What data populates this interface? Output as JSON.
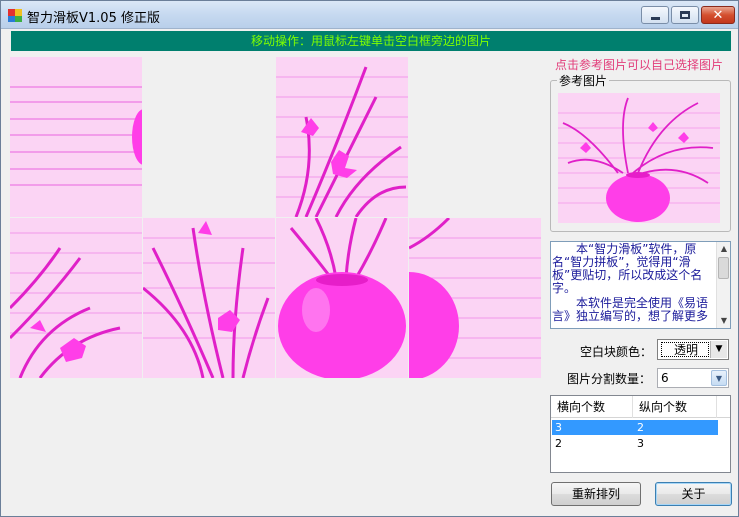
{
  "window": {
    "title": "智力滑板V1.05 修正版",
    "icon": "app-logo-icon"
  },
  "titlebar_buttons": {
    "minimize": "minimize-icon",
    "maximize": "maximize-icon",
    "close_glyph": "✕"
  },
  "banner": {
    "text": "移动操作：用鼠标左键单击空白框旁边的图片",
    "bg": "#007f6e",
    "fg": "#7fff00"
  },
  "board": {
    "columns": 4,
    "rows": 2,
    "tiles": [
      {
        "slot": 1,
        "content": "piece"
      },
      {
        "slot": 2,
        "content": "blank"
      },
      {
        "slot": 3,
        "content": "piece"
      },
      {
        "slot": 4,
        "content": "blank"
      },
      {
        "slot": 5,
        "content": "piece"
      },
      {
        "slot": 6,
        "content": "piece"
      },
      {
        "slot": 7,
        "content": "piece"
      },
      {
        "slot": 8,
        "content": "piece"
      }
    ],
    "tint": "#ff33e6"
  },
  "reference": {
    "hint": "点击参考图片可以自己选择图片",
    "group_title": "参考图片"
  },
  "about_memo": {
    "para1": "本“智力滑板”软件，原名“智力拼板”，觉得用“滑板”更贴切，所以改成这个名字。",
    "para2": "本软件是完全使用《易语言》独立编写的，想了解更多"
  },
  "settings": {
    "blank_color_label": "空白块颜色：",
    "blank_color_value": "透明",
    "split_count_label": "图片分割数量：",
    "split_count_value": "6"
  },
  "split_table": {
    "headers": [
      "横向个数",
      "纵向个数"
    ],
    "rows": [
      {
        "h": "3",
        "v": "2",
        "selected": true
      },
      {
        "h": "2",
        "v": "3",
        "selected": false
      }
    ]
  },
  "buttons": {
    "shuffle": "重新排列",
    "close": "关于"
  }
}
